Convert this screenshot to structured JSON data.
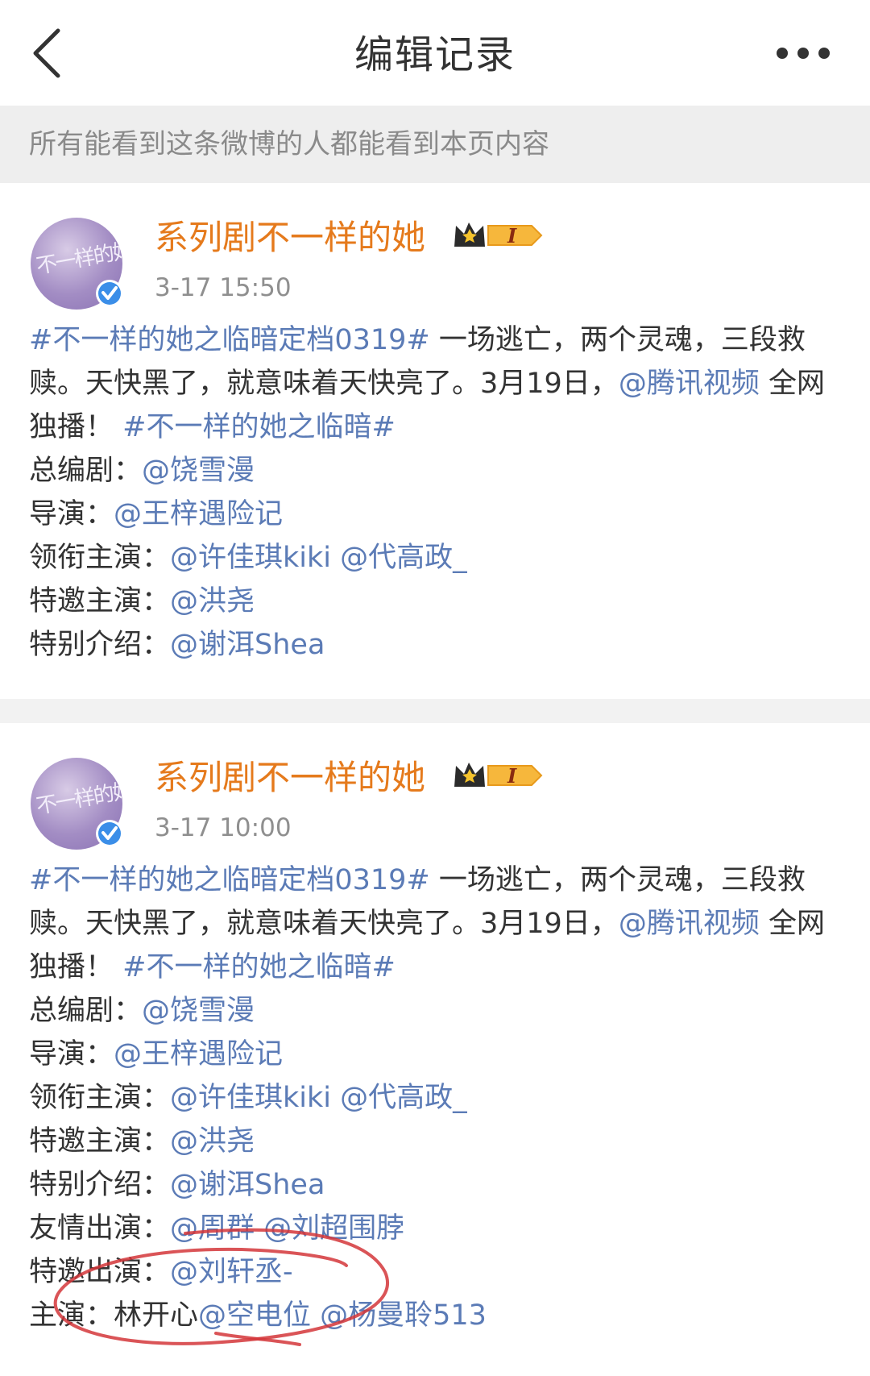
{
  "header": {
    "title": "编辑记录",
    "back_icon": "chevron-left-icon",
    "more_icon": "more-horizontal-icon"
  },
  "notice": "所有能看到这条微博的人都能看到本页内容",
  "colors": {
    "author": "#e57a1c",
    "link": "#5b7bb6",
    "annotation": "#d4363a"
  },
  "posts": [
    {
      "avatar_text": "不一样的她",
      "author": "系列剧不一样的她",
      "time": "3-17 15:50",
      "body": {
        "hashtag1": "#不一样的她之临暗定档0319#",
        "text1a": " 一场逃亡，两个灵魂，三段救赎。天快黑了，就意味着天快亮了。3月19日，",
        "mention_tencent": "@腾讯视频",
        "text1b": " 全网独播！",
        "hashtag2": "#不一样的她之临暗#"
      },
      "credits": [
        {
          "label": "总编剧：",
          "mentions": "@饶雪漫"
        },
        {
          "label": "导演：",
          "mentions": "@王梓遇险记"
        },
        {
          "label": "领衔主演：",
          "mentions": "@许佳琪kiki @代高政_"
        },
        {
          "label": "特邀主演：",
          "mentions": "@洪尧"
        },
        {
          "label": "特别介绍：",
          "mentions": "@谢洱Shea"
        }
      ]
    },
    {
      "avatar_text": "不一样的她",
      "author": "系列剧不一样的她",
      "time": "3-17 10:00",
      "body": {
        "hashtag1": "#不一样的她之临暗定档0319#",
        "text1a": " 一场逃亡，两个灵魂，三段救赎。天快黑了，就意味着天快亮了。3月19日，",
        "mention_tencent": "@腾讯视频",
        "text1b": " 全网独播！",
        "hashtag2": "#不一样的她之临暗#"
      },
      "credits": [
        {
          "label": "总编剧：",
          "mentions": "@饶雪漫"
        },
        {
          "label": "导演：",
          "mentions": "@王梓遇险记"
        },
        {
          "label": "领衔主演：",
          "mentions": "@许佳琪kiki @代高政_"
        },
        {
          "label": "特邀主演：",
          "mentions": "@洪尧"
        },
        {
          "label": "特别介绍：",
          "mentions": "@谢洱Shea"
        },
        {
          "label": "友情出演：",
          "mentions": "@周群 @刘超围脖"
        },
        {
          "label": "特邀出演：",
          "mentions": "@刘轩丞-"
        },
        {
          "label": "主演：林开心",
          "mentions": "@空电位 @杨曼聆513"
        }
      ]
    }
  ]
}
